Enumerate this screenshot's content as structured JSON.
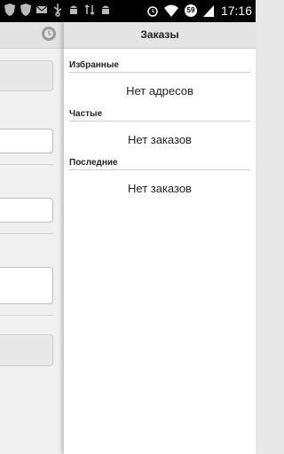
{
  "status_bar": {
    "time": "17:16",
    "battery_level": "59",
    "icons": [
      "shield-icon",
      "shield-icon",
      "mail-icon",
      "usb-icon",
      "android-icon",
      "signal-arrow-icon",
      "android-icon"
    ]
  },
  "drawer": {
    "title": "Заказы",
    "sections": [
      {
        "label": "Избранные",
        "empty_text": "Нет адресов"
      },
      {
        "label": "Частые",
        "empty_text": "Нет заказов"
      },
      {
        "label": "Последние",
        "empty_text": "Нет заказов"
      }
    ]
  },
  "colors": {
    "header_bg": "#e4e4e4",
    "status_bar_bg": "#000000",
    "divider": "#cfcfcf"
  }
}
